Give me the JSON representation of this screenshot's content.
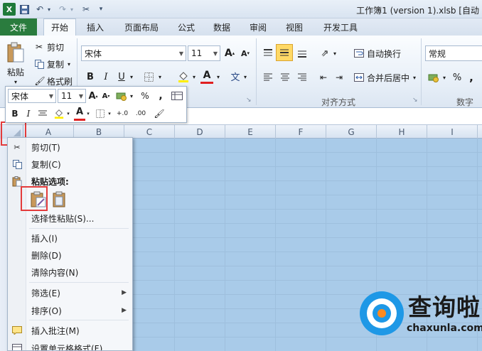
{
  "titlebar": {
    "app_icon": "X",
    "quick_access": [
      "save-icon",
      "undo-icon",
      "redo-icon",
      "customize-icon"
    ],
    "title": "工作簿1 (version 1).xlsb [自动"
  },
  "tabs": [
    "文件",
    "开始",
    "插入",
    "页面布局",
    "公式",
    "数据",
    "审阅",
    "视图",
    "开发工具"
  ],
  "clipboard": {
    "paste": "粘贴",
    "cut": "剪切",
    "copy": "复制",
    "format_painter": "格式刷"
  },
  "font": {
    "name": "宋体",
    "size": "11",
    "bold": "B",
    "italic": "I",
    "underline": "U",
    "grow": "A",
    "shrink": "A",
    "font_color_letter": "A",
    "wen": "文"
  },
  "alignment": {
    "wrap_text": "自动换行",
    "merge_center": "合并后居中",
    "group_label": "对齐方式"
  },
  "number": {
    "format": "常规",
    "percent": "%",
    "comma": ",",
    "group_label": "数字"
  },
  "mini_toolbar": {
    "font": "宋体",
    "size": "11",
    "percent": "%",
    "comma": ",",
    "bold": "B",
    "italic": "I",
    "font_color_letter": "A",
    "inc_decimal": "+.0",
    "dec_decimal": ".00"
  },
  "columns": [
    "A",
    "B",
    "C",
    "D",
    "E",
    "F",
    "G",
    "H",
    "I"
  ],
  "context_menu": {
    "cut": "剪切(T)",
    "copy": "复制(C)",
    "paste_options": "粘贴选项:",
    "paste_special": "选择性粘贴(S)...",
    "insert": "插入(I)",
    "delete": "删除(D)",
    "clear": "清除内容(N)",
    "filter": "筛选(E)",
    "sort": "排序(O)",
    "insert_comment": "插入批注(M)",
    "format_cells": "设置单元格格式(F)..."
  },
  "watermark": {
    "name": "查询啦",
    "url": "chaxunla.com"
  },
  "colors": {
    "selection": "#a9cbe9",
    "file_tab": "#2a7c3e",
    "highlight": "#e33b3b",
    "watermark_blue": "#1e98e6"
  }
}
